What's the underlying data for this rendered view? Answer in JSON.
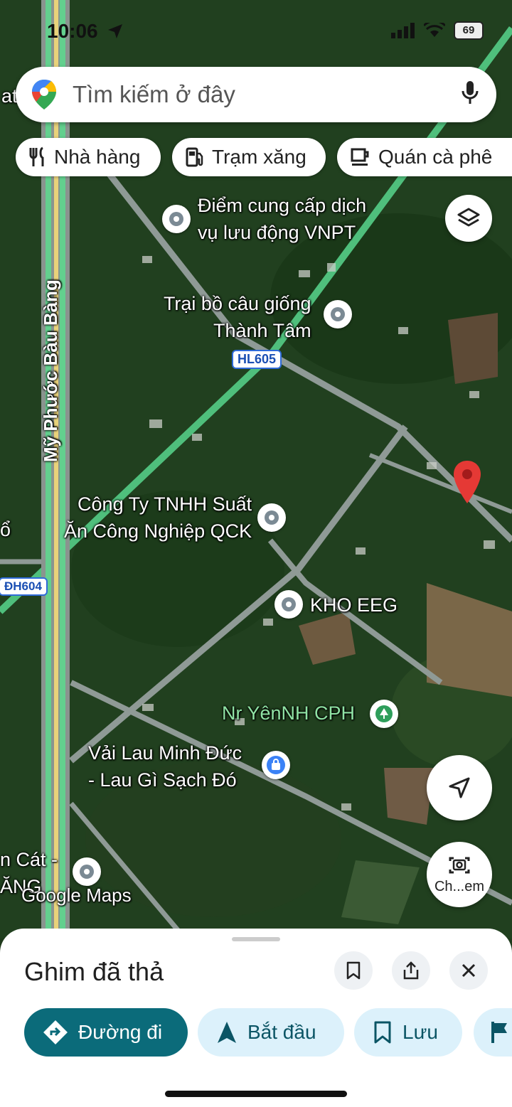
{
  "status": {
    "time": "10:06",
    "battery": "69"
  },
  "search": {
    "placeholder": "Tìm kiếm ở đây"
  },
  "chips": [
    {
      "icon": "restaurant-icon",
      "label": "Nhà hàng"
    },
    {
      "icon": "gas-station-icon",
      "label": "Trạm xăng"
    },
    {
      "icon": "coffee-icon",
      "label": "Quán cà phê"
    }
  ],
  "map": {
    "road_names": {
      "main_road": "Mỹ Phước Bàu Bàng"
    },
    "shields": {
      "hl605": "HL605",
      "dh604": "ĐH604"
    },
    "places": {
      "vnpt_line1": "Điểm cung cấp dịch",
      "vnpt_line2": "vụ lưu động VNPT",
      "trai_line1": "Trại bồ câu giống",
      "trai_line2": "Thành Tâm",
      "qck_line1": "Công Ty TNHH Suất",
      "qck_line2": "Ăn Công Nghiệp QCK",
      "kho": "KHO EEG",
      "nr": "Nr YênNH CPH",
      "vai_line1": "Vải Lau Minh Đức",
      "vai_line2": "- Lau Gì Sạch Đó",
      "edge_left1": "n Cát -",
      "edge_left2": "ĂNG",
      "edge_top": "at",
      "edge_mid": "ổ"
    },
    "watermark": "Google Maps"
  },
  "camera_button": {
    "label": "Ch...em"
  },
  "sheet": {
    "title": "Ghim đã thả",
    "actions": [
      {
        "icon": "directions-icon",
        "label": "Đường đi"
      },
      {
        "icon": "navigation-arrow-icon",
        "label": "Bắt đầu"
      },
      {
        "icon": "bookmark-icon",
        "label": "Lưu"
      }
    ]
  },
  "colors": {
    "primary": "#0b6b7a",
    "secondary_bg": "#dcf1fb",
    "pin": "#e53935",
    "road_highlight": "#5cd68b"
  }
}
